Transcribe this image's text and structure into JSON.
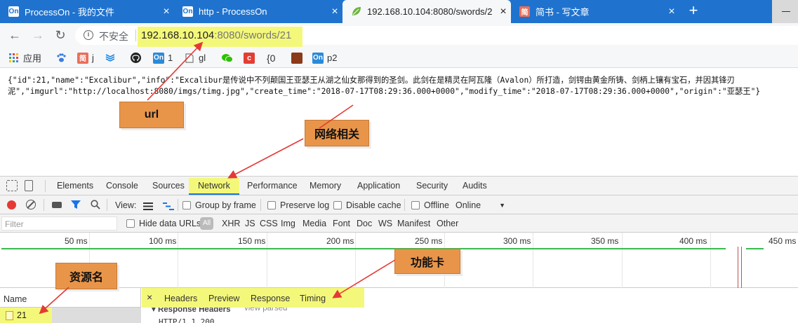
{
  "tabs": [
    {
      "favicon": "On",
      "title": "ProcessOn - 我的文件",
      "close": "×",
      "active": false
    },
    {
      "favicon": "On",
      "title": "http - ProcessOn",
      "close": "×",
      "active": false
    },
    {
      "favicon": "leaf",
      "title": "192.168.10.104:8080/swords/2",
      "close": "×",
      "active": true
    },
    {
      "favicon": "简",
      "title": "简书 - 写文章",
      "close": "×",
      "active": false
    }
  ],
  "new_tab": "+",
  "toolbar": {
    "back": "←",
    "forward": "→",
    "reload": "↻",
    "info_icon": "i",
    "insecure_label": "不安全",
    "url_host": "192.168.10.104",
    "url_rest": ":8080/swords/21"
  },
  "bookmarks": [
    {
      "icon": "apps-grid-icon",
      "label": "应用",
      "color": "#4285f4"
    },
    {
      "icon": "paw-icon",
      "label": "",
      "color": "#3b7ddd"
    },
    {
      "icon": "简",
      "label": "j",
      "color": "#ea6f5a"
    },
    {
      "icon": "layers-icon",
      "label": "",
      "color": "#1e88e5"
    },
    {
      "icon": "github-icon",
      "label": "",
      "color": "#222"
    },
    {
      "icon": "On",
      "label": "1",
      "color": "#2b8ad8"
    },
    {
      "icon": "doc-icon",
      "label": "gl",
      "color": "#777"
    },
    {
      "icon": "wechat-icon",
      "label": "",
      "color": "#2dc100"
    },
    {
      "icon": "csdn-icon",
      "label": "",
      "color": "#e33e33"
    },
    {
      "icon": "{0",
      "label": "",
      "color": "#333"
    },
    {
      "icon": "image-icon",
      "label": "",
      "color": "#8b3a1a"
    },
    {
      "icon": "On",
      "label": "p2",
      "color": "#2b8ad8"
    }
  ],
  "json_lines": [
    "{\"id\":21,\"name\":\"Excalibur\",\"info\":\"Excalibur是传说中不列颠国王亚瑟王从湖之仙女那得到的圣剑。此剑在是精灵在阿瓦隆（Avalon）所打造，剑锷由黄金所铸、剑柄上镶有宝石，并因其锋刃",
    "泥\",\"imgurl\":\"http://localhost:8080/imgs/timg.jpg\",\"create_time\":\"2018-07-17T08:29:36.000+0000\",\"modify_time\":\"2018-07-17T08:29:36.000+0000\",\"origin\":\"亚瑟王\"}"
  ],
  "callouts": {
    "url": "url",
    "network": "网络相关",
    "resource": "资源名",
    "feature": "功能卡"
  },
  "devtools": {
    "tabs": [
      "Elements",
      "Console",
      "Sources",
      "Network",
      "Performance",
      "Memory",
      "Application",
      "Security",
      "Audits"
    ],
    "selected_tab": "Network",
    "view_label": "View:",
    "group_by_frame": "Group by frame",
    "preserve_log": "Preserve log",
    "disable_cache": "Disable cache",
    "offline": "Offline",
    "throttle": "Online",
    "filter_placeholder": "Filter",
    "hide_data_urls": "Hide data URLs",
    "all": "All",
    "types": [
      "XHR",
      "JS",
      "CSS",
      "Img",
      "Media",
      "Font",
      "Doc",
      "WS",
      "Manifest",
      "Other"
    ],
    "ticks": [
      "50 ms",
      "100 ms",
      "150 ms",
      "200 ms",
      "250 ms",
      "300 ms",
      "350 ms",
      "400 ms",
      "450 ms"
    ],
    "name_header": "Name",
    "request_name": "21",
    "detail_close": "×",
    "detail_tabs": [
      "Headers",
      "Preview",
      "Response",
      "Timing"
    ],
    "response_headers": "▾ Response Headers",
    "view_parsed": "view parsed",
    "http_status": "HTTP/1.1 200"
  },
  "colors": {
    "tabstrip": "#1f73cf",
    "highlight": "#f4f87a",
    "callout": "#e8954a",
    "arrow": "#e53935",
    "record": "#e53935",
    "timeline_bar": "#3aba4e"
  }
}
